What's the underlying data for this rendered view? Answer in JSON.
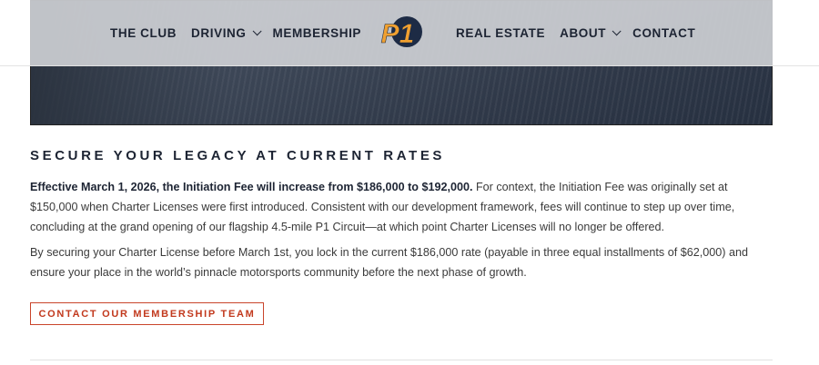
{
  "nav": {
    "left": [
      "THE CLUB",
      "DRIVING",
      "MEMBERSHIP"
    ],
    "right": [
      "REAL ESTATE",
      "ABOUT",
      "CONTACT"
    ],
    "logo_text": "P1"
  },
  "section": {
    "headline": "SECURE YOUR LEGACY AT CURRENT RATES",
    "p1_bold": "Effective March 1, 2026, the Initiation Fee will increase from $186,000 to $192,000.",
    "p1_rest": " For context, the Initiation Fee was originally set at $150,000 when Charter Licenses were first introduced. Consistent with our development framework, fees will continue to step up over time, concluding at the grand opening of our flagship 4.5-mile P1 Circuit—at which point Charter Licenses will no longer be offered.",
    "p2": "By securing your Charter License before March 1st, you lock in the current $186,000 rate (payable in three equal installments of $62,000) and ensure your place in the world’s pinnacle motorsports community before the next phase of growth.",
    "cta_label": "CONTACT OUR MEMBERSHIP TEAM"
  },
  "colors": {
    "accent": "#c2391d",
    "nav_text": "#1d2433",
    "logo_orange": "#f0a030",
    "logo_navy": "#1d2b45"
  }
}
